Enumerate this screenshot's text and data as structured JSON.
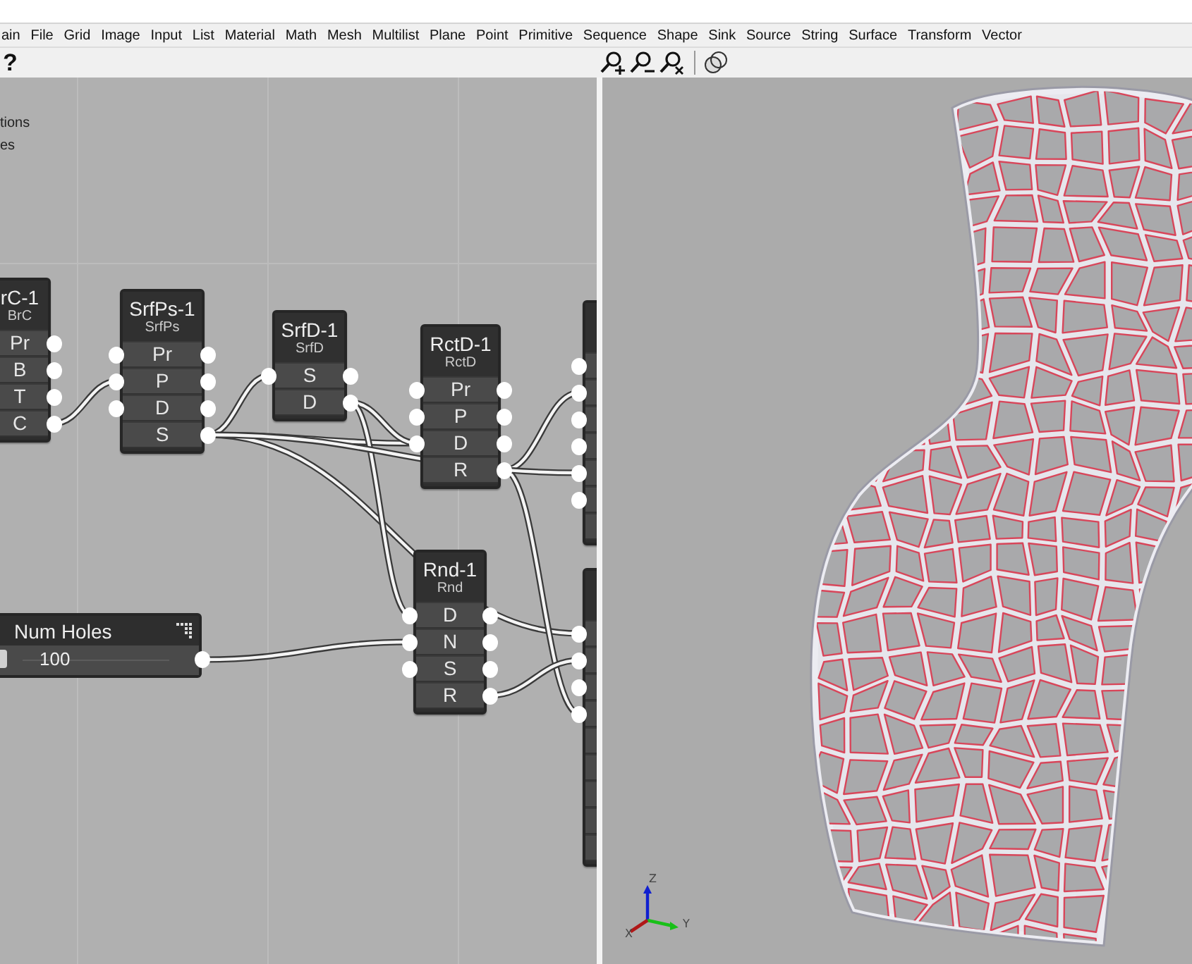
{
  "menu_bar": {
    "items": [
      "ain",
      "File",
      "Grid",
      "Image",
      "Input",
      "List",
      "Material",
      "Math",
      "Mesh",
      "Multilist",
      "Plane",
      "Point",
      "Primitive",
      "Sequence",
      "Shape",
      "Sink",
      "Source",
      "String",
      "Surface",
      "Transform",
      "Vector"
    ]
  },
  "toolbar": {
    "help": "?"
  },
  "canvas": {
    "labels": [
      "tions",
      "es"
    ],
    "nodes": [
      {
        "title": "rC-1",
        "subtitle": "BrC",
        "ports": [
          {
            "label": "Pr",
            "input": false,
            "output": true
          },
          {
            "label": "B",
            "input": false,
            "output": true
          },
          {
            "label": "T",
            "input": false,
            "output": true
          },
          {
            "label": "C",
            "input": false,
            "output": true
          }
        ]
      },
      {
        "title": "SrfPs-1",
        "subtitle": "SrfPs",
        "ports": [
          {
            "label": "Pr",
            "input": true,
            "output": true
          },
          {
            "label": "P",
            "input": true,
            "output": true
          },
          {
            "label": "D",
            "input": true,
            "output": true
          },
          {
            "label": "S",
            "input": false,
            "output": true
          }
        ]
      },
      {
        "title": "SrfD-1",
        "subtitle": "SrfD",
        "ports": [
          {
            "label": "S",
            "input": true,
            "output": true
          },
          {
            "label": "D",
            "input": false,
            "output": true
          }
        ]
      },
      {
        "title": "RctD-1",
        "subtitle": "RctD",
        "ports": [
          {
            "label": "Pr",
            "input": true,
            "output": true
          },
          {
            "label": "P",
            "input": true,
            "output": true
          },
          {
            "label": "D",
            "input": true,
            "output": true
          },
          {
            "label": "R",
            "input": false,
            "output": true
          }
        ]
      },
      {
        "title": "Rnd-1",
        "subtitle": "Rnd",
        "ports": [
          {
            "label": "D",
            "input": true,
            "output": true
          },
          {
            "label": "N",
            "input": true,
            "output": true
          },
          {
            "label": "S",
            "input": true,
            "output": true
          },
          {
            "label": "R",
            "input": false,
            "output": true
          }
        ]
      }
    ],
    "clipped_nodes": [
      {
        "ports": [
          {
            "input": true,
            "output": false
          },
          {
            "input": true,
            "output": false
          },
          {
            "input": true,
            "output": false
          },
          {
            "input": true,
            "output": false
          },
          {
            "input": true,
            "output": false
          },
          {
            "input": true,
            "output": false
          },
          {
            "input": false,
            "output": false
          }
        ]
      },
      {
        "ports": [
          {
            "input": true,
            "output": false
          },
          {
            "input": true,
            "output": false
          },
          {
            "input": true,
            "output": false
          },
          {
            "input": true,
            "output": false
          },
          {
            "input": false,
            "output": false
          },
          {
            "input": false,
            "output": false
          },
          {
            "input": false,
            "output": false
          },
          {
            "input": false,
            "output": false
          },
          {
            "input": false,
            "output": false
          }
        ]
      }
    ],
    "slider": {
      "title": "Num Holes",
      "value": "100",
      "level": 0
    }
  },
  "viewport": {
    "axis_labels": [
      "Z",
      "Y",
      "X"
    ]
  }
}
